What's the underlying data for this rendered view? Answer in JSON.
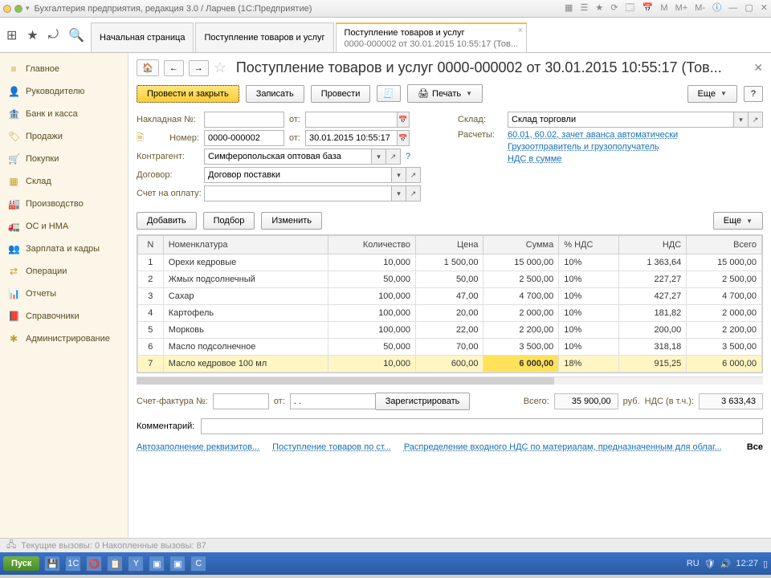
{
  "window_title": "Бухгалтерия предприятия, редакция 3.0 / Ларчев  (1С:Предприятие)",
  "apptoolbar_icons": [
    "grid",
    "star",
    "pin",
    "search"
  ],
  "tabs": [
    {
      "label": "Начальная страница",
      "sub": "",
      "active": false,
      "closable": false
    },
    {
      "label": "Поступление товаров и услуг",
      "sub": "",
      "active": false,
      "closable": false
    },
    {
      "label": "Поступление товаров и услуг",
      "sub": "0000-000002 от 30.01.2015 10:55:17 (Тов...",
      "active": true,
      "closable": true
    }
  ],
  "sidebar": {
    "items": [
      {
        "icon": "≡",
        "label": "Главное"
      },
      {
        "icon": "👤",
        "label": "Руководителю"
      },
      {
        "icon": "🏦",
        "label": "Банк и касса"
      },
      {
        "icon": "🏷",
        "label": "Продажи"
      },
      {
        "icon": "🛒",
        "label": "Покупки"
      },
      {
        "icon": "▦",
        "label": "Склад"
      },
      {
        "icon": "🏭",
        "label": "Производство"
      },
      {
        "icon": "🚛",
        "label": "ОС и НМА"
      },
      {
        "icon": "👥",
        "label": "Зарплата и кадры"
      },
      {
        "icon": "⇄",
        "label": "Операции"
      },
      {
        "icon": "📊",
        "label": "Отчеты"
      },
      {
        "icon": "📕",
        "label": "Справочники"
      },
      {
        "icon": "✱",
        "label": "Администрирование"
      }
    ]
  },
  "doc": {
    "title": "Поступление товаров и услуг 0000-000002 от 30.01.2015 10:55:17 (Тов...",
    "toolbar": {
      "post_close": "Провести и закрыть",
      "write": "Записать",
      "post": "Провести",
      "print": "Печать",
      "more": "Еще"
    },
    "fields": {
      "invoice_lbl": "Накладная №:",
      "invoice": "",
      "from_lbl": "от:",
      "invoice_date": "",
      "doc_no_lbl": "Номер:",
      "doc_no": "0000-000002",
      "doc_date": "30.01.2015 10:55:17",
      "counterparty_lbl": "Контрагент:",
      "counterparty": "Симферопольская оптовая база",
      "contract_lbl": "Договор:",
      "contract": "Договор поставки",
      "payment_account_lbl": "Счет на оплату:",
      "payment_account": "",
      "warehouse_lbl": "Склад:",
      "warehouse": "Склад торговли",
      "calc_lbl": "Расчеты:",
      "calc_link": "60.01, 60.02, зачет аванса автоматически",
      "shipper_link": "Грузоотправитель и грузополучатель",
      "vat_link": "НДС в сумме"
    },
    "table": {
      "buttons": {
        "add": "Добавить",
        "pick": "Подбор",
        "edit": "Изменить",
        "more": "Еще"
      },
      "columns": [
        "N",
        "Номенклатура",
        "Количество",
        "Цена",
        "Сумма",
        "% НДС",
        "НДС",
        "Всего"
      ],
      "rows": [
        {
          "n": 1,
          "name": "Орехи кедровые",
          "qty": "10,000",
          "price": "1 500,00",
          "sum": "15 000,00",
          "vat_pct": "10%",
          "vat": "1 363,64",
          "total": "15 000,00",
          "sel": false
        },
        {
          "n": 2,
          "name": "Жмых подсолнечный",
          "qty": "50,000",
          "price": "50,00",
          "sum": "2 500,00",
          "vat_pct": "10%",
          "vat": "227,27",
          "total": "2 500,00",
          "sel": false
        },
        {
          "n": 3,
          "name": "Сахар",
          "qty": "100,000",
          "price": "47,00",
          "sum": "4 700,00",
          "vat_pct": "10%",
          "vat": "427,27",
          "total": "4 700,00",
          "sel": false
        },
        {
          "n": 4,
          "name": "Картофель",
          "qty": "100,000",
          "price": "20,00",
          "sum": "2 000,00",
          "vat_pct": "10%",
          "vat": "181,82",
          "total": "2 000,00",
          "sel": false
        },
        {
          "n": 5,
          "name": "Морковь",
          "qty": "100,000",
          "price": "22,00",
          "sum": "2 200,00",
          "vat_pct": "10%",
          "vat": "200,00",
          "total": "2 200,00",
          "sel": false
        },
        {
          "n": 6,
          "name": "Масло подсолнечное",
          "qty": "50,000",
          "price": "70,00",
          "sum": "3 500,00",
          "vat_pct": "10%",
          "vat": "318,18",
          "total": "3 500,00",
          "sel": false
        },
        {
          "n": 7,
          "name": "Масло кедровое 100 мл",
          "qty": "10,000",
          "price": "600,00",
          "sum": "6 000,00",
          "vat_pct": "18%",
          "vat": "915,25",
          "total": "6 000,00",
          "sel": true
        }
      ]
    },
    "totals": {
      "sf_lbl": "Счет-фактура №:",
      "sf": "",
      "sf_from": "от:",
      "sf_date": ". .",
      "register": "Зарегистрировать",
      "total_lbl": "Всего:",
      "total": "35 900,00",
      "currency": "руб.",
      "vat_lbl": "НДС (в т.ч.):",
      "vat": "3 633,43"
    },
    "comment_lbl": "Комментарий:",
    "comment": "",
    "links": {
      "autofill": "Автозаполнение реквизитов...",
      "receipt": "Поступление товаров по ст...",
      "vat_dist": "Распределение входного НДС по материалам, предназначенным для облаг...",
      "all": "Все"
    }
  },
  "status1": {
    "left_icon": "⎙",
    "text": "Текущие вызовы: 0  Накопленные вызовы: 87"
  },
  "taskbar": {
    "start": "Пуск",
    "tray": {
      "lang": "RU",
      "time": "12:27"
    }
  }
}
